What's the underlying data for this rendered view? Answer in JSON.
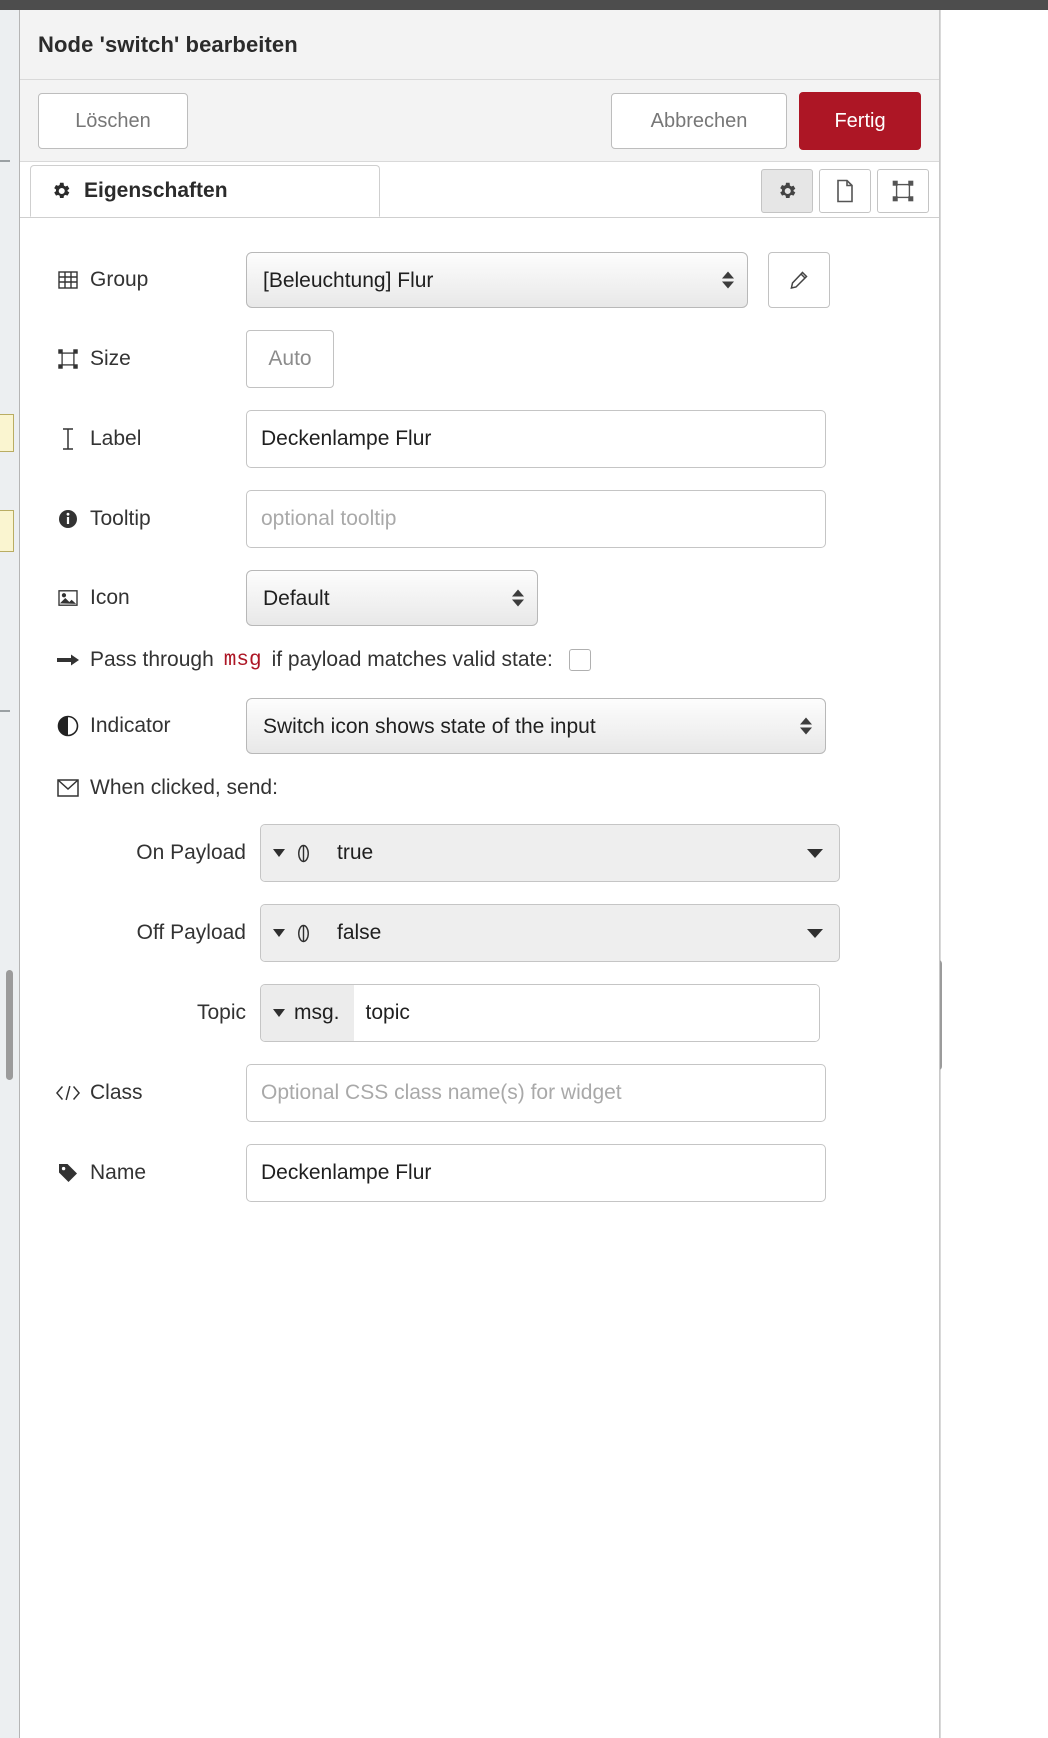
{
  "dialog": {
    "title": "Node 'switch' bearbeiten",
    "buttons": {
      "delete": "Löschen",
      "cancel": "Abbrechen",
      "done": "Fertig"
    },
    "tabs": [
      {
        "label": "Eigenschaften",
        "icon": "gear-icon"
      }
    ],
    "tab_icon_buttons": [
      {
        "name": "properties-icon",
        "glyph": "gear"
      },
      {
        "name": "description-icon",
        "glyph": "document"
      },
      {
        "name": "appearance-icon",
        "glyph": "layout"
      }
    ]
  },
  "form": {
    "group": {
      "label": "Group",
      "icon": "table-icon",
      "value": "[Beleuchtung] Flur",
      "edit_button": "pencil-icon"
    },
    "size": {
      "label": "Size",
      "icon": "resize-icon",
      "value": "Auto"
    },
    "label_field": {
      "label": "Label",
      "icon": "text-cursor-icon",
      "value": "Deckenlampe Flur"
    },
    "tooltip": {
      "label": "Tooltip",
      "icon": "info-icon",
      "value": "",
      "placeholder": "optional tooltip"
    },
    "icon_field": {
      "label": "Icon",
      "icon": "image-icon",
      "value": "Default"
    },
    "passthrough": {
      "icon": "arrow-right-icon",
      "text_before": "Pass through",
      "code": "msg",
      "text_after": "if payload matches valid state:",
      "checked": false
    },
    "indicator": {
      "label": "Indicator",
      "icon": "contrast-icon",
      "value": "Switch icon shows state of the input"
    },
    "when_clicked": {
      "label": "When clicked, send:",
      "icon": "envelope-icon"
    },
    "on_payload": {
      "label": "On Payload",
      "type_glyph": "bool-icon",
      "value": "true"
    },
    "off_payload": {
      "label": "Off Payload",
      "type_glyph": "bool-icon",
      "value": "false"
    },
    "topic": {
      "label": "Topic",
      "prefix": "msg.",
      "value": "topic"
    },
    "css_class": {
      "label": "Class",
      "icon": "code-icon",
      "value": "",
      "placeholder": "Optional CSS class name(s) for widget"
    },
    "name": {
      "label": "Name",
      "icon": "tag-icon",
      "value": "Deckenlampe Flur"
    }
  },
  "colors": {
    "accent_red": "#ad1625",
    "header_bg": "#f3f3f3",
    "code_red": "#ad1625"
  }
}
